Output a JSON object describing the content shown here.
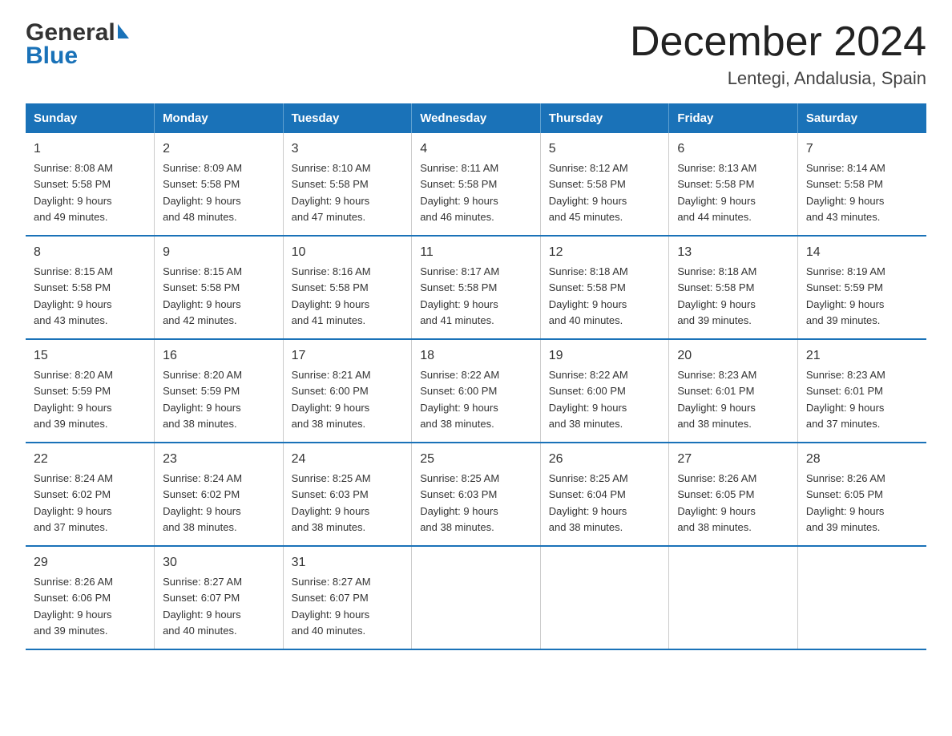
{
  "header": {
    "logo_line1": "General",
    "logo_line2": "Blue",
    "title": "December 2024",
    "subtitle": "Lentegi, Andalusia, Spain"
  },
  "weekdays": [
    "Sunday",
    "Monday",
    "Tuesday",
    "Wednesday",
    "Thursday",
    "Friday",
    "Saturday"
  ],
  "weeks": [
    [
      {
        "day": "1",
        "sunrise": "8:08 AM",
        "sunset": "5:58 PM",
        "daylight": "9 hours and 49 minutes."
      },
      {
        "day": "2",
        "sunrise": "8:09 AM",
        "sunset": "5:58 PM",
        "daylight": "9 hours and 48 minutes."
      },
      {
        "day": "3",
        "sunrise": "8:10 AM",
        "sunset": "5:58 PM",
        "daylight": "9 hours and 47 minutes."
      },
      {
        "day": "4",
        "sunrise": "8:11 AM",
        "sunset": "5:58 PM",
        "daylight": "9 hours and 46 minutes."
      },
      {
        "day": "5",
        "sunrise": "8:12 AM",
        "sunset": "5:58 PM",
        "daylight": "9 hours and 45 minutes."
      },
      {
        "day": "6",
        "sunrise": "8:13 AM",
        "sunset": "5:58 PM",
        "daylight": "9 hours and 44 minutes."
      },
      {
        "day": "7",
        "sunrise": "8:14 AM",
        "sunset": "5:58 PM",
        "daylight": "9 hours and 43 minutes."
      }
    ],
    [
      {
        "day": "8",
        "sunrise": "8:15 AM",
        "sunset": "5:58 PM",
        "daylight": "9 hours and 43 minutes."
      },
      {
        "day": "9",
        "sunrise": "8:15 AM",
        "sunset": "5:58 PM",
        "daylight": "9 hours and 42 minutes."
      },
      {
        "day": "10",
        "sunrise": "8:16 AM",
        "sunset": "5:58 PM",
        "daylight": "9 hours and 41 minutes."
      },
      {
        "day": "11",
        "sunrise": "8:17 AM",
        "sunset": "5:58 PM",
        "daylight": "9 hours and 41 minutes."
      },
      {
        "day": "12",
        "sunrise": "8:18 AM",
        "sunset": "5:58 PM",
        "daylight": "9 hours and 40 minutes."
      },
      {
        "day": "13",
        "sunrise": "8:18 AM",
        "sunset": "5:58 PM",
        "daylight": "9 hours and 39 minutes."
      },
      {
        "day": "14",
        "sunrise": "8:19 AM",
        "sunset": "5:59 PM",
        "daylight": "9 hours and 39 minutes."
      }
    ],
    [
      {
        "day": "15",
        "sunrise": "8:20 AM",
        "sunset": "5:59 PM",
        "daylight": "9 hours and 39 minutes."
      },
      {
        "day": "16",
        "sunrise": "8:20 AM",
        "sunset": "5:59 PM",
        "daylight": "9 hours and 38 minutes."
      },
      {
        "day": "17",
        "sunrise": "8:21 AM",
        "sunset": "6:00 PM",
        "daylight": "9 hours and 38 minutes."
      },
      {
        "day": "18",
        "sunrise": "8:22 AM",
        "sunset": "6:00 PM",
        "daylight": "9 hours and 38 minutes."
      },
      {
        "day": "19",
        "sunrise": "8:22 AM",
        "sunset": "6:00 PM",
        "daylight": "9 hours and 38 minutes."
      },
      {
        "day": "20",
        "sunrise": "8:23 AM",
        "sunset": "6:01 PM",
        "daylight": "9 hours and 38 minutes."
      },
      {
        "day": "21",
        "sunrise": "8:23 AM",
        "sunset": "6:01 PM",
        "daylight": "9 hours and 37 minutes."
      }
    ],
    [
      {
        "day": "22",
        "sunrise": "8:24 AM",
        "sunset": "6:02 PM",
        "daylight": "9 hours and 37 minutes."
      },
      {
        "day": "23",
        "sunrise": "8:24 AM",
        "sunset": "6:02 PM",
        "daylight": "9 hours and 38 minutes."
      },
      {
        "day": "24",
        "sunrise": "8:25 AM",
        "sunset": "6:03 PM",
        "daylight": "9 hours and 38 minutes."
      },
      {
        "day": "25",
        "sunrise": "8:25 AM",
        "sunset": "6:03 PM",
        "daylight": "9 hours and 38 minutes."
      },
      {
        "day": "26",
        "sunrise": "8:25 AM",
        "sunset": "6:04 PM",
        "daylight": "9 hours and 38 minutes."
      },
      {
        "day": "27",
        "sunrise": "8:26 AM",
        "sunset": "6:05 PM",
        "daylight": "9 hours and 38 minutes."
      },
      {
        "day": "28",
        "sunrise": "8:26 AM",
        "sunset": "6:05 PM",
        "daylight": "9 hours and 39 minutes."
      }
    ],
    [
      {
        "day": "29",
        "sunrise": "8:26 AM",
        "sunset": "6:06 PM",
        "daylight": "9 hours and 39 minutes."
      },
      {
        "day": "30",
        "sunrise": "8:27 AM",
        "sunset": "6:07 PM",
        "daylight": "9 hours and 40 minutes."
      },
      {
        "day": "31",
        "sunrise": "8:27 AM",
        "sunset": "6:07 PM",
        "daylight": "9 hours and 40 minutes."
      },
      null,
      null,
      null,
      null
    ]
  ]
}
